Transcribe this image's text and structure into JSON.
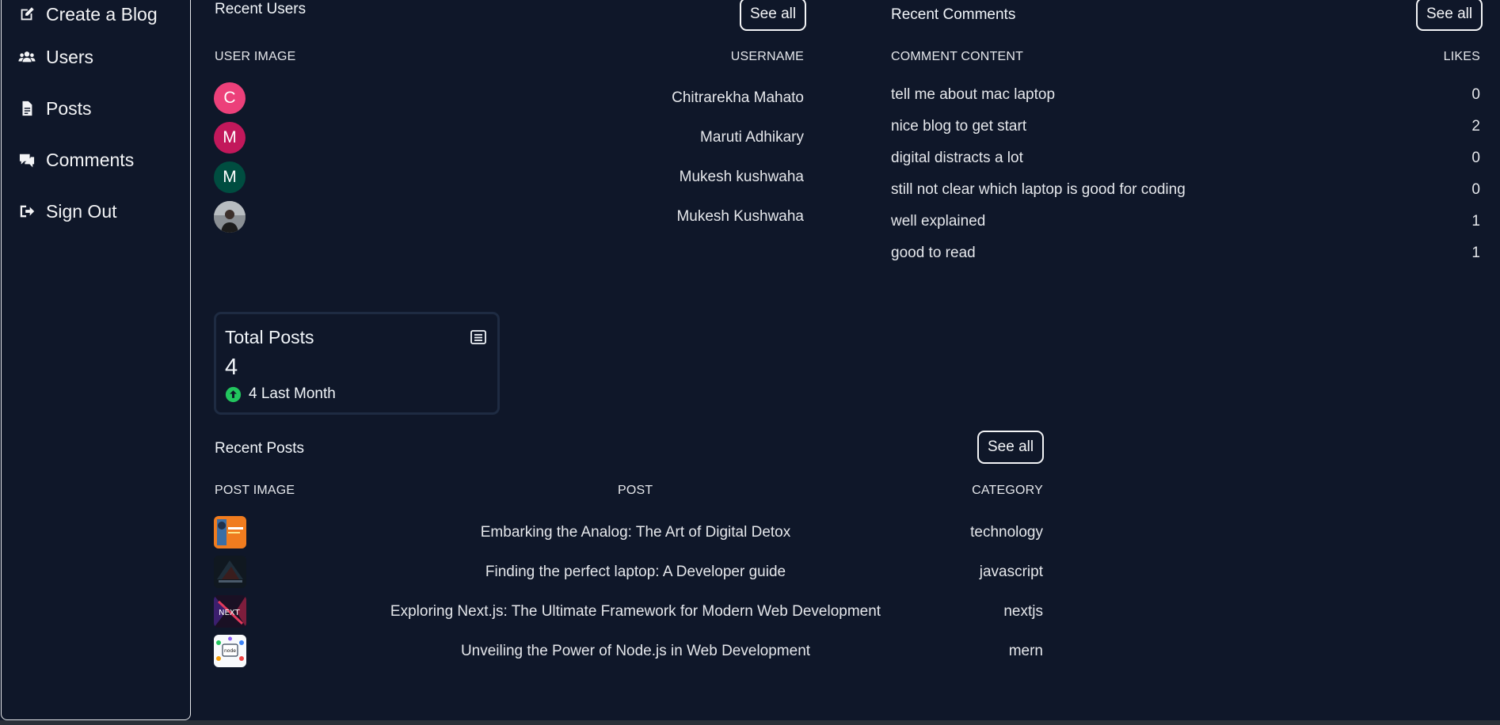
{
  "sidebar": {
    "items": [
      {
        "label": "Create a Blog",
        "icon": "edit-square-icon"
      },
      {
        "label": "Users",
        "icon": "users-icon"
      },
      {
        "label": "Posts",
        "icon": "document-icon"
      },
      {
        "label": "Comments",
        "icon": "comments-icon"
      },
      {
        "label": "Sign Out",
        "icon": "sign-out-icon"
      }
    ]
  },
  "recent_users": {
    "title": "Recent Users",
    "see_all": "See all",
    "col_image": "USER IMAGE",
    "col_username": "USERNAME",
    "rows": [
      {
        "initial": "C",
        "username": "Chitrarekha Mahato",
        "color": "#ec407a"
      },
      {
        "initial": "M",
        "username": "Maruti Adhikary",
        "color": "#c2185b"
      },
      {
        "initial": "M",
        "username": "Mukesh kushwaha",
        "color": "#004d40"
      },
      {
        "initial": "",
        "username": "Mukesh Kushwaha",
        "color": "#6b6b6b"
      }
    ]
  },
  "recent_comments": {
    "title": "Recent Comments",
    "see_all": "See all",
    "col_content": "COMMENT CONTENT",
    "col_likes": "LIKES",
    "rows": [
      {
        "content": "tell me about mac laptop",
        "likes": "0"
      },
      {
        "content": "nice blog to get start",
        "likes": "2"
      },
      {
        "content": "digital distracts a lot",
        "likes": "0"
      },
      {
        "content": "still not clear which laptop is good for coding",
        "likes": "0"
      },
      {
        "content": "well explained",
        "likes": "1"
      },
      {
        "content": "good to read",
        "likes": "1"
      }
    ]
  },
  "total_posts": {
    "title": "Total Posts",
    "value": "4",
    "trend": "4 Last Month",
    "trend_color": "#22c55e"
  },
  "recent_posts": {
    "title": "Recent Posts",
    "see_all": "See all",
    "col_image": "POST IMAGE",
    "col_post": "POST",
    "col_category": "CATEGORY",
    "rows": [
      {
        "title": "Embarking the Analog: The Art of Digital Detox",
        "category": "technology"
      },
      {
        "title": "Finding the perfect laptop: A Developer guide",
        "category": "javascript"
      },
      {
        "title": "Exploring Next.js: The Ultimate Framework for Modern Web Development",
        "category": "nextjs"
      },
      {
        "title": "Unveiling the Power of Node.js in Web Development",
        "category": "mern"
      }
    ]
  },
  "colors": {
    "background": "#0f1729",
    "text": "#f1f5f9",
    "border": "#e5e7eb"
  }
}
